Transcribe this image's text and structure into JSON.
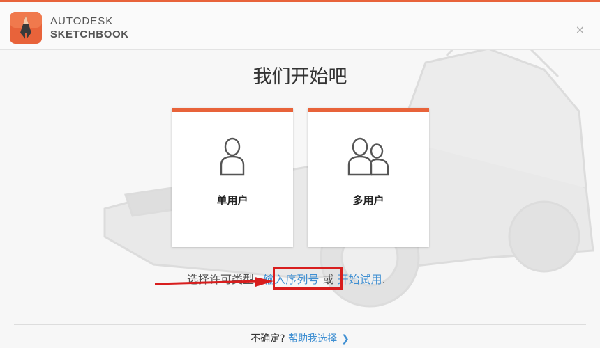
{
  "header": {
    "brand_line1": "AUTODESK",
    "brand_line2": "SKETCHBOOK",
    "close_symbol": "×"
  },
  "main": {
    "title": "我们开始吧",
    "cards": [
      {
        "label": "单用户",
        "icon": "single-user-icon"
      },
      {
        "label": "多用户",
        "icon": "multi-user-icon"
      }
    ],
    "license": {
      "prefix": "选择许可类型:",
      "serial_link": "输入序列号",
      "or": "或",
      "trial_link": "开始试用",
      "suffix": "."
    }
  },
  "footer": {
    "question": "不确定?",
    "help_link": "帮助我选择",
    "chevron": "❯"
  },
  "colors": {
    "accent": "#e8633a",
    "link": "#3f8fd2",
    "highlight": "#d81e1e"
  }
}
